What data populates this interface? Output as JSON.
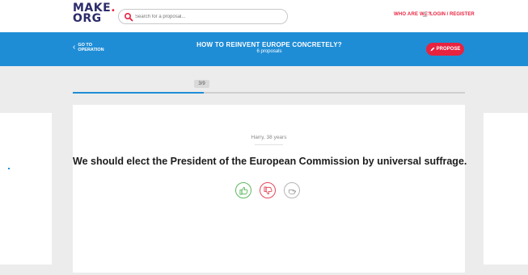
{
  "header": {
    "logo_line1": "MAKE",
    "logo_dot": ".",
    "logo_line2": "ORG",
    "search_placeholder": "Search for a proposal...",
    "nav_who": "WHO ARE WE?",
    "nav_login": "LOGIN / REGISTER"
  },
  "banner": {
    "goto_line1": "GO TO",
    "goto_line2": "OPERATION",
    "question": "HOW TO REINVENT EUROPE CONCRETELY?",
    "proposals_count": "6 proposals",
    "propose_label": "PROPOSE"
  },
  "progress": {
    "counter": "3/9",
    "fraction": 0.333
  },
  "card": {
    "author": "Harry, 38 years",
    "proposal_text": "We should elect the President of the European Commission by universal suffrage."
  },
  "votes": [
    {
      "name": "agree",
      "icon": "thumbs-up-icon",
      "color": "#5fb85f"
    },
    {
      "name": "disagree",
      "icon": "thumbs-down-icon",
      "color": "#e24a5a"
    },
    {
      "name": "neutral",
      "icon": "hand-neutral-icon",
      "color": "#b5b5b5"
    }
  ],
  "colors": {
    "brand_blue": "#1f8dd6",
    "brand_red": "#e8233f",
    "logo_navy": "#2b2b6b"
  }
}
